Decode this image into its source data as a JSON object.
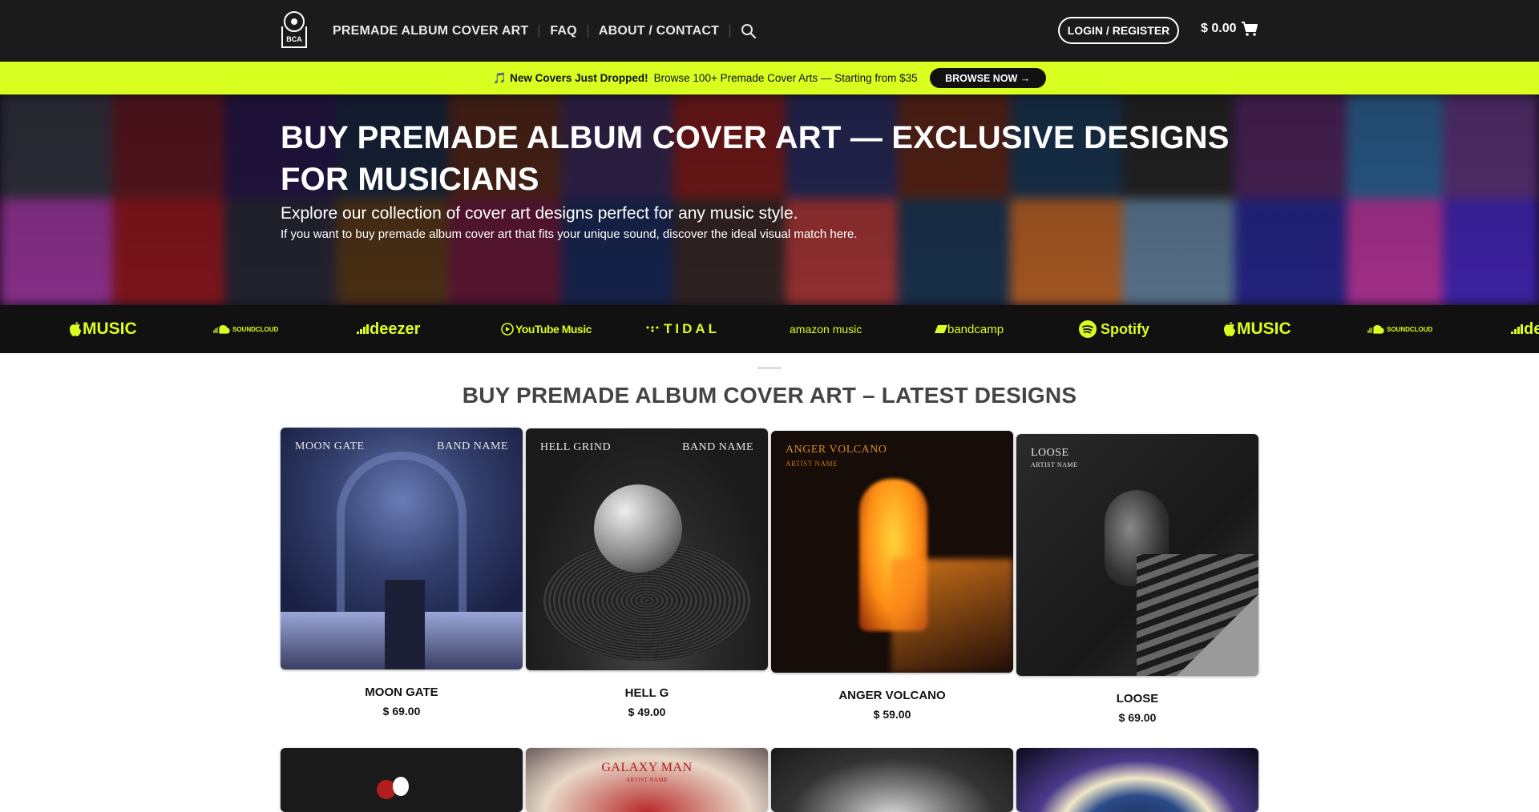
{
  "header": {
    "logo_text": "BCA",
    "nav": [
      "PREMADE ALBUM COVER ART",
      "FAQ",
      "ABOUT / CONTACT"
    ],
    "login_label": "LOGIN / REGISTER",
    "cart_total": "$ 0.00"
  },
  "announcement": {
    "emoji": "🎵",
    "headline": "New Covers Just Dropped!",
    "text": "Browse 100+ Premade Cover Arts — Starting from $35",
    "button": "BROWSE NOW →"
  },
  "hero": {
    "title": "BUY PREMADE ALBUM COVER ART — EXCLUSIVE DESIGNS FOR MUSICIANS",
    "subtitle": "Explore our collection of cover art designs perfect for any music style.",
    "subtitle2": "If you want to buy premade album cover art that fits your unique sound, discover the ideal visual match here."
  },
  "platforms": [
    "MUSIC",
    "SOUNDCLOUD",
    "deezer",
    "YouTube Music",
    "TIDAL",
    "amazon music",
    "bandcamp",
    "Spotify",
    "MUSIC",
    "SOUNDCLOUD",
    "de"
  ],
  "section": {
    "title": "BUY PREMADE ALBUM COVER ART – LATEST DESIGNS"
  },
  "products": [
    {
      "name": "MOON GATE",
      "price": "$ 69.00",
      "cover_left": "MOON GATE",
      "cover_right": "BAND NAME"
    },
    {
      "name": "HELL G",
      "price": "$ 49.00",
      "cover_left": "HELL GRIND",
      "cover_right": "BAND NAME"
    },
    {
      "name": "ANGER VOLCANO",
      "price": "$ 59.00",
      "cover_left": "ANGER VOLCANO",
      "cover_sub": "ARTIST NAME"
    },
    {
      "name": "LOOSE",
      "price": "$ 69.00",
      "cover_left": "LOOSE",
      "cover_sub": "ARTIST NAME"
    }
  ],
  "products_row2": [
    {
      "cover_left": ""
    },
    {
      "cover_left": "GALAXY MAN",
      "cover_sub": "ARTIST NAME"
    },
    {
      "cover_left": ""
    },
    {
      "cover_left": ""
    }
  ],
  "colors": {
    "accent": "#d8ff1f",
    "header_bg": "#1b1b1b",
    "strip_bg": "#111111"
  }
}
